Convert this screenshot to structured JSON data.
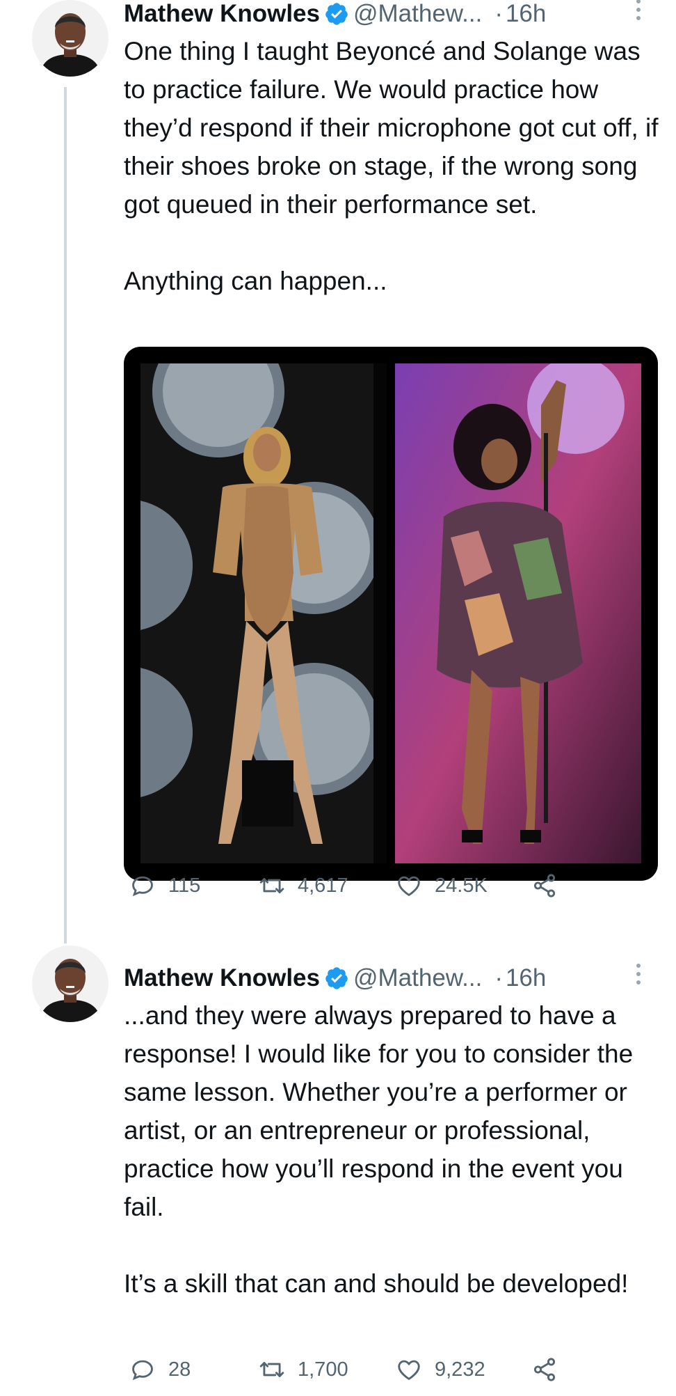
{
  "tweets": [
    {
      "author": "Mathew Knowles",
      "handle": "@Mathew...",
      "separator": "·",
      "time": "16h",
      "text": "One thing I taught Beyoncé and Solange was to practice failure. We would practice how they’d respond if their microphone got cut off, if their shoes broke on stage, if the wrong song got queued in their performance set.\n\nAnything can happen...",
      "stats": {
        "replies": "115",
        "retweets": "4,617",
        "likes": "24.5K"
      },
      "icons": {
        "reply": "reply-icon",
        "retweet": "retweet-icon",
        "like": "like-icon",
        "share": "share-icon"
      }
    },
    {
      "author": "Mathew Knowles",
      "handle": "@Mathew...",
      "separator": "·",
      "time": "16h",
      "text": "...and they were always prepared to have a response! I would like for you to consider the same lesson. Whether you’re a performer or artist, or an entrepreneur or professional, practice how you’ll respond in the event you fail.\n\nIt’s a skill that can and should be developed!",
      "stats": {
        "replies": "28",
        "retweets": "1,700",
        "likes": "9,232"
      },
      "icons": {
        "reply": "reply-icon",
        "retweet": "retweet-icon",
        "like": "like-icon",
        "share": "share-icon"
      }
    }
  ],
  "colors": {
    "verified": "#1d9bf0",
    "muted": "#536471",
    "thread_line": "#cfd9de"
  }
}
